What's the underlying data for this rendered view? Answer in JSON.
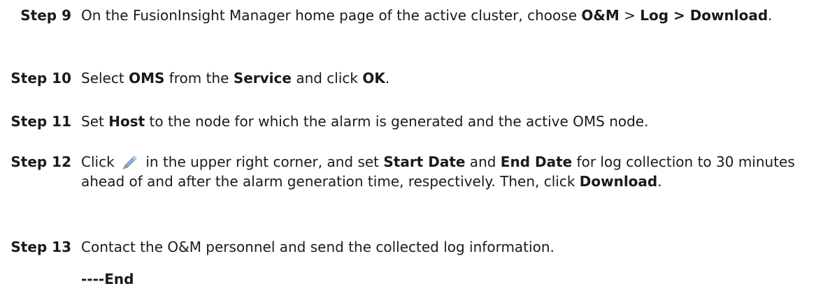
{
  "steps": [
    {
      "label": "Step 9",
      "parts": [
        {
          "t": "On the FusionInsight Manager home page of the active cluster, choose ",
          "b": false
        },
        {
          "t": "O&M",
          "b": true
        },
        {
          "t": " > ",
          "b": false
        },
        {
          "t": "Log > Download",
          "b": true
        },
        {
          "t": ".",
          "b": false
        }
      ]
    },
    {
      "label": "Step 10",
      "parts": [
        {
          "t": "Select ",
          "b": false
        },
        {
          "t": "OMS",
          "b": true
        },
        {
          "t": " from the ",
          "b": false
        },
        {
          "t": "Service",
          "b": true
        },
        {
          "t": " and click ",
          "b": false
        },
        {
          "t": "OK",
          "b": true
        },
        {
          "t": ".",
          "b": false
        }
      ]
    },
    {
      "label": "Step 11",
      "parts": [
        {
          "t": "Set ",
          "b": false
        },
        {
          "t": "Host",
          "b": true
        },
        {
          "t": " to the node for which the alarm is generated and the active OMS node.",
          "b": false
        }
      ]
    },
    {
      "label": "Step 12",
      "parts": [
        {
          "t": "Click ",
          "b": false
        },
        {
          "icon": "pencil-icon"
        },
        {
          "t": " in the upper right corner, and set ",
          "b": false
        },
        {
          "t": "Start Date",
          "b": true
        },
        {
          "t": " and ",
          "b": false
        },
        {
          "t": "End Date",
          "b": true
        },
        {
          "t": " for log collection to 30 minutes ahead of and after the alarm generation time, respectively. Then, click ",
          "b": false
        },
        {
          "t": "Download",
          "b": true
        },
        {
          "t": ".",
          "b": false
        }
      ]
    },
    {
      "label": "Step 13",
      "parts": [
        {
          "t": "Contact the O&M personnel and send the collected log information.",
          "b": false
        }
      ]
    }
  ],
  "end_marker": "----End",
  "colors": {
    "text": "#1a1a1a",
    "pencil_body": "#8fb4e6",
    "pencil_tip": "#d9a25f"
  }
}
